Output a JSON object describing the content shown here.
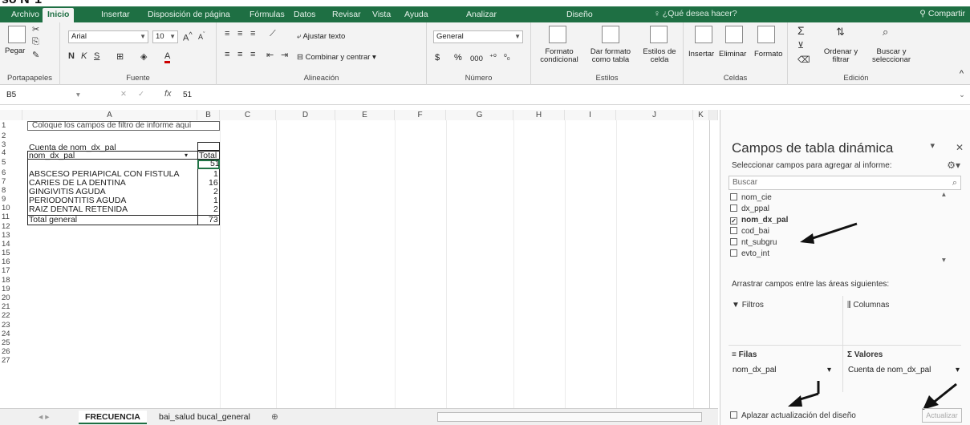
{
  "title_fragment": "so N°1",
  "tabs": [
    "Archivo",
    "Inicio",
    "Insertar",
    "Disposición de página",
    "Fórmulas",
    "Datos",
    "Revisar",
    "Vista",
    "Ayuda",
    "Analizar",
    "Diseño"
  ],
  "tell_me": "¿Qué desea hacer?",
  "share": "Compartir",
  "ribbon": {
    "clipboard": {
      "paste": "Pegar",
      "label": "Portapapeles"
    },
    "font": {
      "name": "Arial",
      "size": "10",
      "bold": "N",
      "italic": "K",
      "underline": "S",
      "label": "Fuente"
    },
    "alignment": {
      "wrap": "Ajustar texto",
      "merge": "Combinar y centrar",
      "label": "Alineación"
    },
    "number": {
      "format": "General",
      "currency": "$",
      "percent": "%",
      "thousands": "000",
      "label": "Número"
    },
    "styles": {
      "conditional": "Formato condicional",
      "as_table": "Dar formato como tabla",
      "cell_styles": "Estilos de celda",
      "label": "Estilos"
    },
    "cells": {
      "insert": "Insertar",
      "delete": "Eliminar",
      "format": "Formato",
      "label": "Celdas"
    },
    "editing": {
      "sort": "Ordenar y filtrar",
      "find": "Buscar y seleccionar",
      "label": "Edición"
    }
  },
  "formula_bar": {
    "name_box": "B5",
    "fx": "fx",
    "value": "51"
  },
  "columns": [
    "A",
    "B",
    "C",
    "D",
    "E",
    "F",
    "G",
    "H",
    "I",
    "J",
    "K"
  ],
  "rows": [
    "1",
    "2",
    "3",
    "4",
    "5",
    "6",
    "7",
    "8",
    "9",
    "10",
    "11",
    "12",
    "13",
    "14",
    "15",
    "16",
    "17",
    "18",
    "19",
    "20",
    "21",
    "22",
    "23",
    "24",
    "25",
    "26",
    "27"
  ],
  "sheet": {
    "filter_hint": "Coloque los campos de filtro de informe aquí",
    "pivot_title": "Cuenta de nom_dx_pal",
    "row_field": "nom_dx_pal",
    "total_header": "Total",
    "blank_value": "51",
    "items": [
      {
        "label": "ABSCESO PERIAPICAL CON FISTULA",
        "value": "1"
      },
      {
        "label": "CARIES DE LA DENTINA",
        "value": "16"
      },
      {
        "label": "GINGIVITIS AGUDA",
        "value": "2"
      },
      {
        "label": "PERIODONTITIS AGUDA",
        "value": "1"
      },
      {
        "label": "RAIZ DENTAL RETENIDA",
        "value": "2"
      }
    ],
    "grand_total_label": "Total general",
    "grand_total_value": "73"
  },
  "sheet_tabs": [
    "FRECUENCIA",
    "bai_salud bucal_general"
  ],
  "pivot_pane": {
    "title": "Campos de tabla dinámica",
    "subtitle": "Seleccionar campos para agregar al informe:",
    "search_placeholder": "Buscar",
    "fields": [
      {
        "name": "nom_cie",
        "checked": false
      },
      {
        "name": "dx_ppal",
        "checked": false
      },
      {
        "name": "nom_dx_pal",
        "checked": true
      },
      {
        "name": "cod_bai",
        "checked": false
      },
      {
        "name": "nt_subgru",
        "checked": false
      },
      {
        "name": "evto_int",
        "checked": false
      }
    ],
    "drag_label": "Arrastrar campos entre las áreas siguientes:",
    "filters_label": "Filtros",
    "columns_label": "Columnas",
    "rows_label": "Filas",
    "values_label": "Valores",
    "rows_value": "nom_dx_pal",
    "values_value": "Cuenta de nom_dx_pal",
    "defer_label": "Aplazar actualización del diseño",
    "update_button": "Actualizar"
  },
  "colors": {
    "excel_green": "#1e6f43",
    "arrow": "#111111"
  }
}
